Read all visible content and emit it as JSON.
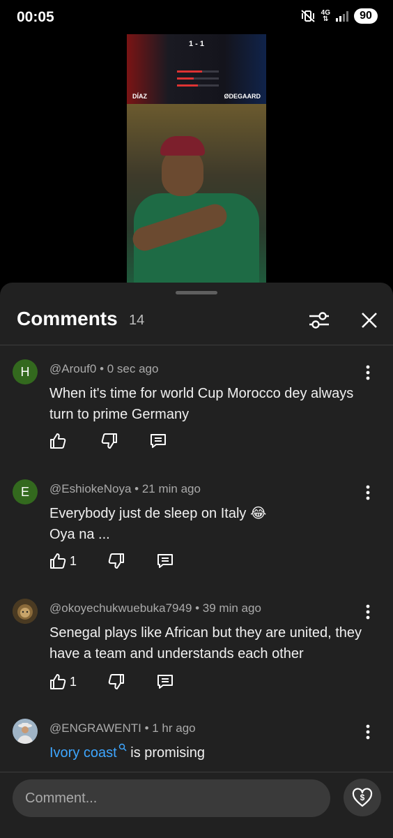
{
  "status_bar": {
    "time": "00:05",
    "network": "4G",
    "battery": "90"
  },
  "video": {
    "score": "1 - 1",
    "player_left": "DÍAZ",
    "player_right": "ØDEGAARD"
  },
  "comments_panel": {
    "title": "Comments",
    "count": "14",
    "comments": [
      {
        "avatar_letter": "H",
        "avatar_color": "#33691e",
        "meta": "@Arouf0 • 0 sec ago",
        "text": "When it's time for world Cup Morocco dey always turn to prime Germany",
        "likes": ""
      },
      {
        "avatar_letter": "E",
        "avatar_color": "#33691e",
        "meta": "@EshiokeNoya • 21 min ago",
        "line1": "Everybody just de sleep on Italy",
        "emoji": "😂",
        "line2": "Oya na ...",
        "likes": "1"
      },
      {
        "avatar_letter": "",
        "avatar_color": "#5d4a2a",
        "meta": "@okoyechukwuebuka7949 • 39 min ago",
        "text": "Senegal plays like African but they are united, they have a team and understands each other",
        "likes": "1"
      },
      {
        "avatar_letter": "",
        "avatar_color": "#8aa1b5",
        "meta": "@ENGRAWENTI • 1 hr ago",
        "link_text": "Ivory coast",
        "text_rest": " is promising"
      }
    ]
  },
  "composer": {
    "placeholder": "Comment..."
  },
  "icons": {
    "filter": "sliders-icon",
    "close": "close-icon",
    "like": "thumbs-up-icon",
    "dislike": "thumbs-down-icon",
    "reply": "reply-icon",
    "more": "more-vert-icon",
    "super_thanks": "super-thanks-icon"
  }
}
